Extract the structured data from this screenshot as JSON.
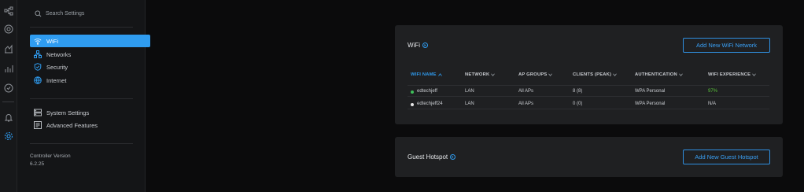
{
  "colors": {
    "accent": "#2f9cf0",
    "online": "#3fbf5a",
    "offline": "#e8e8e8",
    "good": "#59c13a"
  },
  "rail": {
    "icons": [
      "topology-icon",
      "devices-icon",
      "statistics-icon",
      "insights-icon",
      "shield-icon",
      "bell-icon",
      "settings-gear-icon"
    ]
  },
  "sidebar": {
    "search_placeholder": "Search Settings",
    "items": [
      {
        "label": "WiFi",
        "icon": "wifi-icon",
        "active": true
      },
      {
        "label": "Networks",
        "icon": "networks-icon"
      },
      {
        "label": "Security",
        "icon": "shield-icon"
      },
      {
        "label": "Internet",
        "icon": "globe-icon"
      }
    ],
    "system_items": [
      {
        "label": "System Settings",
        "icon": "system-icon"
      },
      {
        "label": "Advanced Features",
        "icon": "advanced-icon"
      }
    ],
    "controller_version_label": "Controller Version",
    "controller_version": "6.2.25"
  },
  "wifi_card": {
    "title": "WiFi",
    "add_button": "Add New WiFi Network",
    "columns": [
      "WIFI NAME",
      "NETWORK",
      "AP GROUPS",
      "CLIENTS (PEAK)",
      "AUTHENTICATION",
      "WIFI EXPERIENCE"
    ],
    "rows": [
      {
        "status": "online",
        "name": "edtechjeff",
        "network": "LAN",
        "ap_groups": "All APs",
        "clients": "8 (8)",
        "auth": "WPA Personal",
        "experience": "97%"
      },
      {
        "status": "offline",
        "name": "edtechjeff24",
        "network": "LAN",
        "ap_groups": "All APs",
        "clients": "0 (0)",
        "auth": "WPA Personal",
        "experience": "N/A"
      }
    ]
  },
  "guest_card": {
    "title": "Guest Hotspot",
    "add_button": "Add New Guest Hotspot"
  }
}
